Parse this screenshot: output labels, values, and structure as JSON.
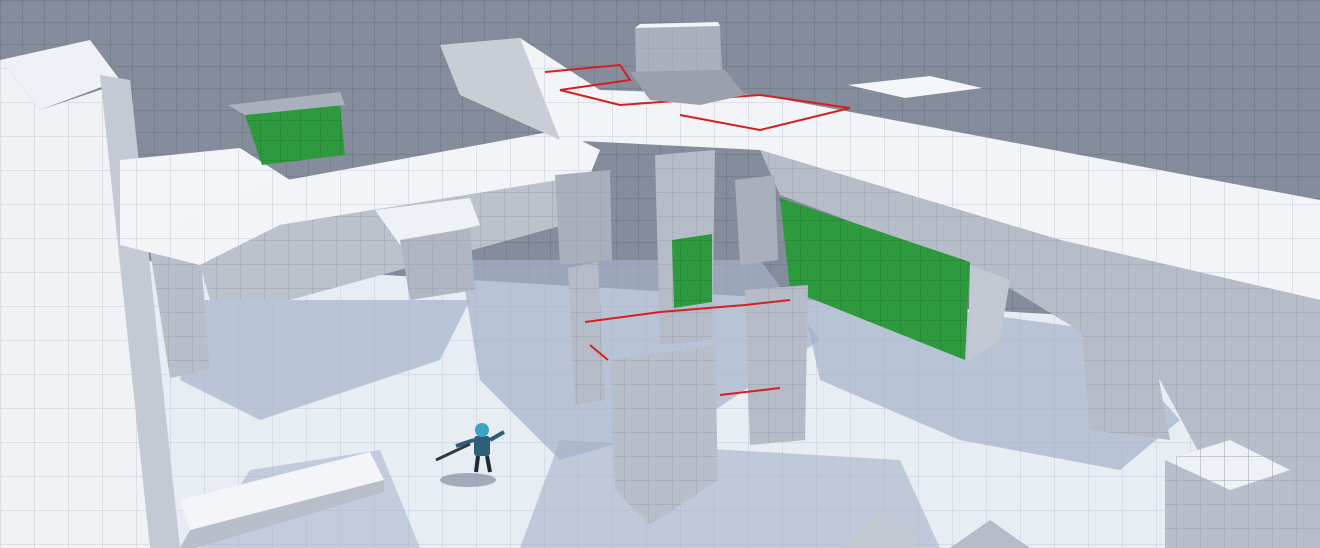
{
  "scene": {
    "view": "game-3d-viewport",
    "colors": {
      "sky_wall": "#858d9c",
      "floor": "#e8edf4",
      "floor_shade": "#aab6cc",
      "structure_top": "#f2f4f7",
      "structure_side": "#b9bfca",
      "structure_dark": "#8e95a2",
      "green_panel": "#2e9a3e",
      "red_edge": "#d42020",
      "grid_line": "#6f7785"
    },
    "objects": [
      {
        "name": "player-character",
        "kind": "character with rifle"
      },
      {
        "name": "green-wall-panel",
        "kind": "colored wall"
      },
      {
        "name": "central-pillar",
        "kind": "structure"
      },
      {
        "name": "overhead-walkway",
        "kind": "structure"
      }
    ]
  }
}
